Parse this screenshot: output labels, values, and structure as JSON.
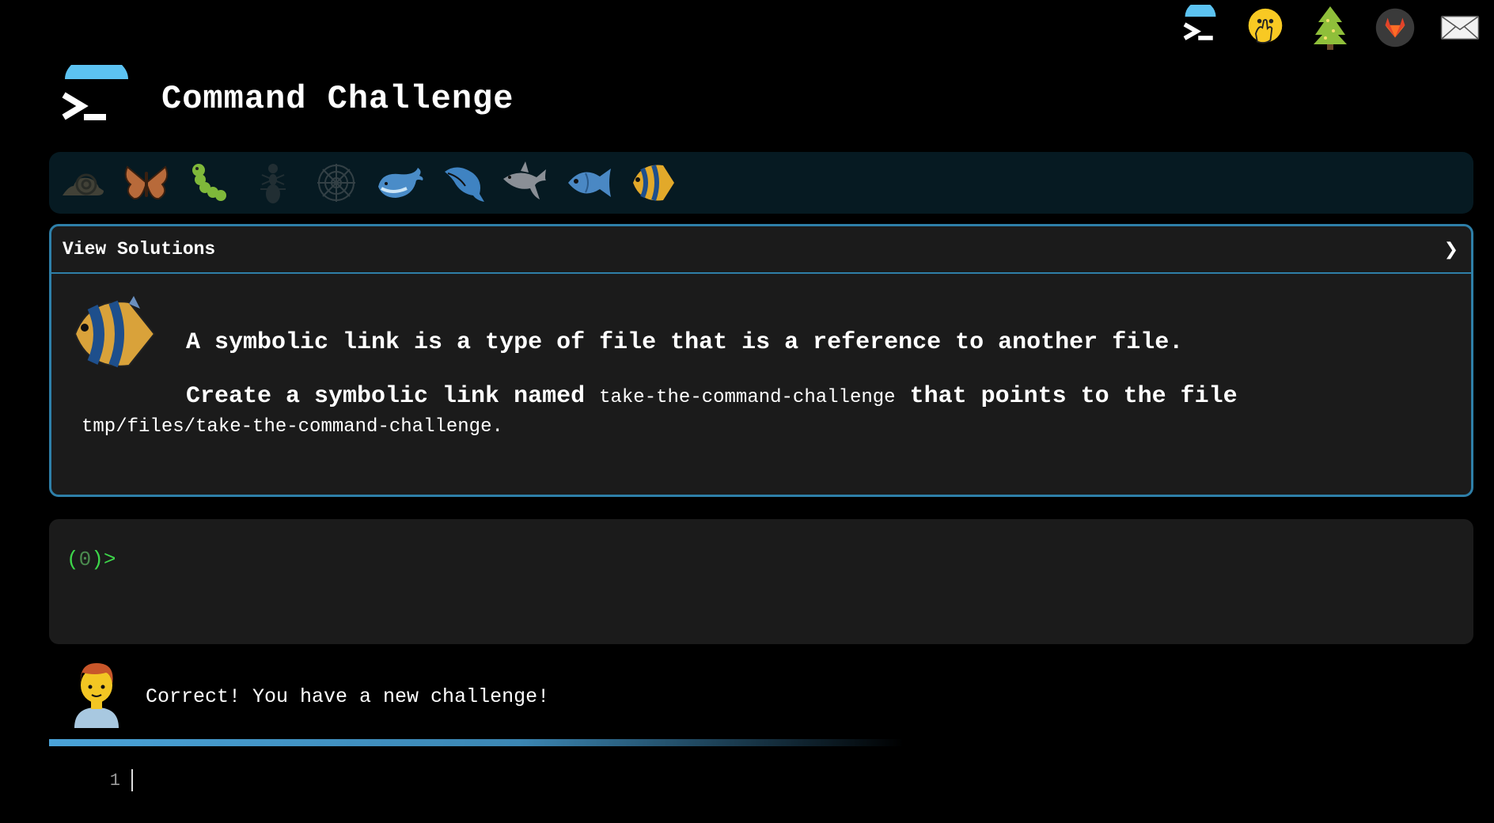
{
  "top_icons": [
    {
      "name": "terminal-icon",
      "label": "Command Challenge home"
    },
    {
      "name": "hand-over-mouth-icon",
      "label": "oops"
    },
    {
      "name": "tree-icon",
      "label": "tree"
    },
    {
      "name": "gitlab-icon",
      "label": "GitLab"
    },
    {
      "name": "envelope-icon",
      "label": "contact"
    }
  ],
  "header": {
    "title": "Command Challenge"
  },
  "levels": [
    {
      "name": "snail-icon",
      "state": "dim"
    },
    {
      "name": "butterfly-icon",
      "state": "active"
    },
    {
      "name": "caterpillar-icon",
      "state": "active"
    },
    {
      "name": "ant-icon",
      "state": "dim"
    },
    {
      "name": "spider-web-icon",
      "state": "dim"
    },
    {
      "name": "whale-icon",
      "state": "active"
    },
    {
      "name": "dolphin-icon",
      "state": "active"
    },
    {
      "name": "shark-icon",
      "state": "active"
    },
    {
      "name": "fish-icon",
      "state": "active"
    },
    {
      "name": "tropical-fish-icon",
      "state": "active"
    }
  ],
  "panel": {
    "header_label": "View Solutions",
    "chevron": "❯",
    "line1": "A symbolic link is a type of file that is a reference to another file.",
    "line2_prefix": "Create a symbolic link named ",
    "line2_code": "take-the-command-challenge",
    "line2_suffix": " that points to the file",
    "line3_code": "tmp/files/take-the-command-challenge",
    "line3_suffix": "."
  },
  "terminal": {
    "prompt_open": "(",
    "prompt_count": "0",
    "prompt_close": ")>"
  },
  "feedback": {
    "message": "Correct! You have a new challenge!"
  },
  "progress": {
    "fraction": 0.6
  },
  "editor": {
    "line_number": "1"
  },
  "colors": {
    "background": "#000000",
    "panel": "#1b1b1b",
    "accent_border": "#2e7fa8",
    "prompt_green": "#3dd64a",
    "progress_blue": "#4aa3d8"
  }
}
